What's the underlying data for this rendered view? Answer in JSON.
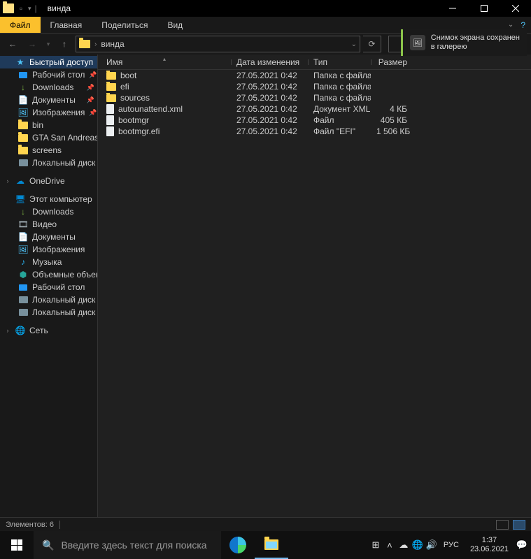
{
  "window": {
    "title": "винда"
  },
  "ribbon": {
    "file": "Файл",
    "tabs": [
      "Главная",
      "Поделиться",
      "Вид"
    ]
  },
  "address": {
    "crumbs": [
      "винда"
    ]
  },
  "notification": {
    "line1": "Снимок экрана сохранен",
    "line2": "в галерею"
  },
  "sidebar": {
    "quick_access": {
      "label": "Быстрый доступ",
      "items": [
        {
          "icon": "desk",
          "label": "Рабочий стол",
          "pin": true
        },
        {
          "icon": "down",
          "label": "Downloads",
          "pin": true
        },
        {
          "icon": "doc",
          "label": "Документы",
          "pin": true
        },
        {
          "icon": "img",
          "label": "Изображения",
          "pin": true
        },
        {
          "icon": "fold",
          "label": "bin"
        },
        {
          "icon": "fold",
          "label": "GTA San Andreas"
        },
        {
          "icon": "fold",
          "label": "screens"
        },
        {
          "icon": "disk",
          "label": "Локальный диск (D:)"
        }
      ]
    },
    "onedrive": {
      "label": "OneDrive"
    },
    "this_pc": {
      "label": "Этот компьютер",
      "items": [
        {
          "icon": "down",
          "label": "Downloads"
        },
        {
          "icon": "video",
          "label": "Видео"
        },
        {
          "icon": "doc",
          "label": "Документы"
        },
        {
          "icon": "img",
          "label": "Изображения"
        },
        {
          "icon": "music",
          "label": "Музыка"
        },
        {
          "icon": "obj3d",
          "label": "Объемные объекты"
        },
        {
          "icon": "desk",
          "label": "Рабочий стол"
        },
        {
          "icon": "disk",
          "label": "Локальный диск (C:)"
        },
        {
          "icon": "disk",
          "label": "Локальный диск (D:)"
        }
      ]
    },
    "network": {
      "label": "Сеть"
    }
  },
  "columns": {
    "name": "Имя",
    "date": "Дата изменения",
    "type": "Тип",
    "size": "Размер"
  },
  "files": [
    {
      "icon": "fold",
      "name": "boot",
      "date": "27.05.2021 0:42",
      "type": "Папка с файлами",
      "size": ""
    },
    {
      "icon": "fold",
      "name": "efi",
      "date": "27.05.2021 0:42",
      "type": "Папка с файлами",
      "size": ""
    },
    {
      "icon": "fold",
      "name": "sources",
      "date": "27.05.2021 0:42",
      "type": "Папка с файлами",
      "size": ""
    },
    {
      "icon": "file",
      "name": "autounattend.xml",
      "date": "27.05.2021 0:42",
      "type": "Документ XML",
      "size": "4 КБ"
    },
    {
      "icon": "file",
      "name": "bootmgr",
      "date": "27.05.2021 0:42",
      "type": "Файл",
      "size": "405 КБ"
    },
    {
      "icon": "file",
      "name": "bootmgr.efi",
      "date": "27.05.2021 0:42",
      "type": "Файл \"EFI\"",
      "size": "1 506 КБ"
    }
  ],
  "status": {
    "count": "Элементов: 6"
  },
  "taskbar": {
    "search_placeholder": "Введите здесь текст для поиска",
    "lang": "РУС",
    "time": "1:37",
    "date": "23.06.2021"
  }
}
